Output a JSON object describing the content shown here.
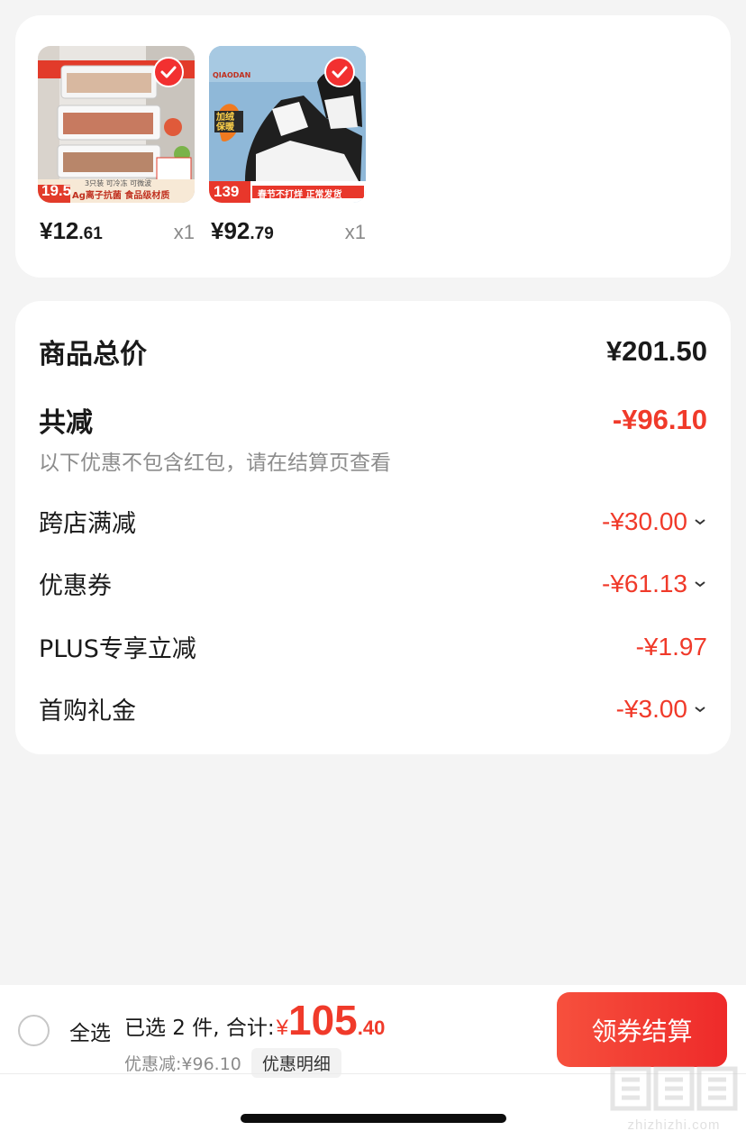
{
  "products": [
    {
      "name": "storage-boxes",
      "price_int": "¥12",
      "price_cents": ".61",
      "qty": "x1",
      "badge_price": "19.5",
      "banner_text": "Ag离子抗菌 食品级材质",
      "tag_text": "3只装 可冷冻 可微波"
    },
    {
      "name": "sneakers",
      "price_int": "¥92",
      "price_cents": ".79",
      "qty": "x1",
      "badge_price": "139",
      "banner_text": "春节不打烊 正常发货",
      "tag_text": "加绒保暖",
      "brand": "QIAODAN"
    }
  ],
  "summary": {
    "total_label": "商品总价",
    "total_value": "¥201.50",
    "reduce_label": "共减",
    "reduce_value": "-¥96.10",
    "note": "以下优惠不包含红包，请在结算页查看",
    "items": [
      {
        "label": "跨店满减",
        "value": "-¥30.00",
        "expandable": true
      },
      {
        "label": "优惠券",
        "value": "-¥61.13",
        "expandable": true
      },
      {
        "label": "PLUS专享立减",
        "value": "-¥1.97",
        "expandable": false
      },
      {
        "label": "首购礼金",
        "value": "-¥3.00",
        "expandable": true
      }
    ]
  },
  "bottom": {
    "select_all": "全选",
    "selected_text": "已选 2 件, 合计:",
    "currency": "¥",
    "total_int": "105",
    "total_cents": ".40",
    "discount_text": "优惠减:¥96.10",
    "detail_label": "优惠明细",
    "checkout_label": "领券结算"
  },
  "watermark": "zhizhizhi.com",
  "colors": {
    "accent": "#f03a2a",
    "background": "#f4f4f4",
    "card": "#ffffff"
  }
}
